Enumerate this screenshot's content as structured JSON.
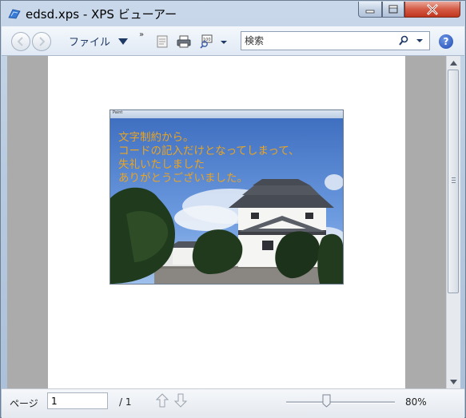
{
  "window": {
    "title": "edsd.xps - XPS ビューアー"
  },
  "toolbar": {
    "file_menu_label": "ファイル",
    "overflow_label": "»",
    "search_placeholder": "検索",
    "help_label": "?"
  },
  "document": {
    "image_window_title": "Paint",
    "overlay_text": [
      "文字制約から。",
      "コードの記入だけとなってしまって、",
      "失礼いたしました",
      "ありがとうございました。"
    ],
    "overlay_text_color": "#e9a423"
  },
  "statusbar": {
    "page_label": "ページ",
    "current_page": "1",
    "total_pages": "/ 1",
    "zoom_level": "80%",
    "zoom_fraction": 0.34
  },
  "colors": {
    "close_button": "#c0361f",
    "chrome": "#b9cbe0"
  }
}
